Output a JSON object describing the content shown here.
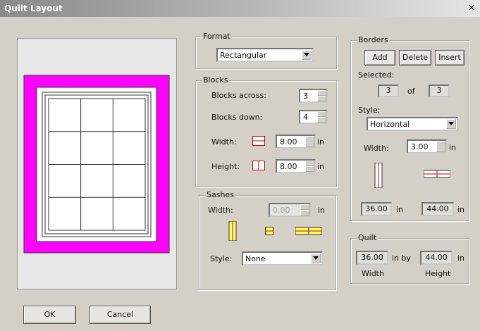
{
  "window": {
    "title": "Quilt Layout",
    "close_glyph": "×"
  },
  "format": {
    "legend": "Format",
    "selected": "Rectangular"
  },
  "blocks": {
    "legend": "Blocks",
    "across_label": "Blocks across:",
    "across_value": "3",
    "down_label": "Blocks down:",
    "down_value": "4",
    "width_label": "Width:",
    "width_value": "8.00",
    "width_unit": "in",
    "height_label": "Height:",
    "height_value": "8.00",
    "height_unit": "in"
  },
  "sashes": {
    "legend": "Sashes",
    "width_label": "Width:",
    "width_value": "0.00",
    "width_unit": "in",
    "style_label": "Style:",
    "style_value": "None"
  },
  "borders": {
    "legend": "Borders",
    "add_label": "Add",
    "delete_label": "Delete",
    "insert_label": "Insert",
    "selected_label": "Selected:",
    "selected_value": "3",
    "of_label": "of",
    "total_value": "3",
    "style_label": "Style:",
    "style_value": "Horizontal",
    "width_label": "Width:",
    "width_value": "3.00",
    "width_unit": "in",
    "vertical_length": "36.00",
    "vertical_unit": "in",
    "horizontal_length": "44.00",
    "horizontal_unit": "in"
  },
  "quilt": {
    "legend": "Quilt",
    "width_value": "36.00",
    "by_label": "in by",
    "height_value": "44.00",
    "unit": "in",
    "width_caption": "Width",
    "height_caption": "Height"
  },
  "footer": {
    "ok_label": "OK",
    "cancel_label": "Cancel"
  },
  "colors": {
    "border_color": "#ff00ff",
    "sash_color": "#ffff66",
    "accent_red": "#cc0000"
  }
}
